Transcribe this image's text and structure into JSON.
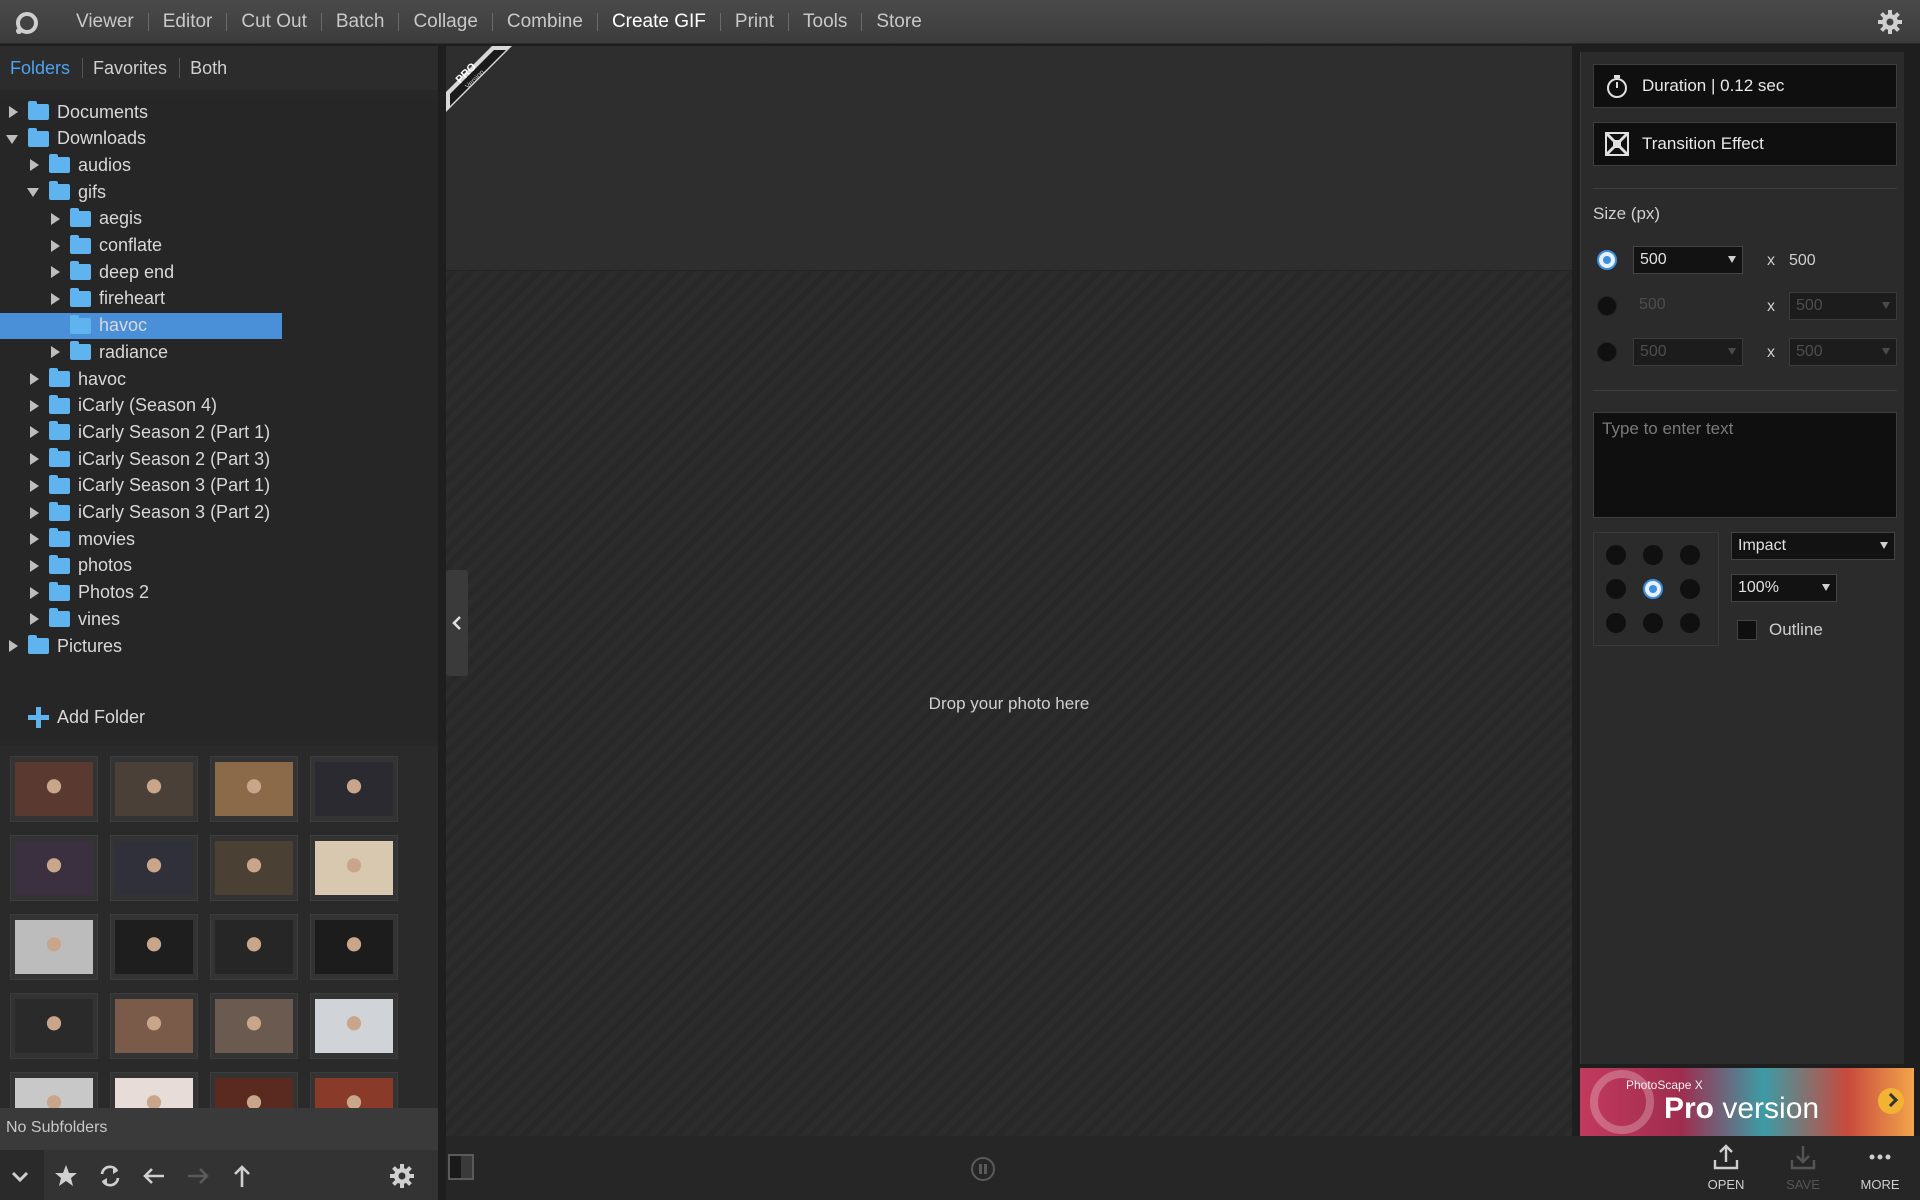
{
  "menu": {
    "items": [
      "Viewer",
      "Editor",
      "Cut Out",
      "Batch",
      "Collage",
      "Combine",
      "Create GIF",
      "Print",
      "Tools",
      "Store"
    ],
    "active": "Create GIF"
  },
  "left": {
    "tabs": [
      "Folders",
      "Favorites",
      "Both"
    ],
    "active_tab": "Folders",
    "tree": [
      {
        "label": "Documents",
        "level": 0,
        "expander": "collapsed"
      },
      {
        "label": "Downloads",
        "level": 0,
        "expander": "expanded"
      },
      {
        "label": "audios",
        "level": 1,
        "expander": "collapsed"
      },
      {
        "label": "gifs",
        "level": 1,
        "expander": "expanded"
      },
      {
        "label": "aegis",
        "level": 2,
        "expander": "collapsed"
      },
      {
        "label": "conflate",
        "level": 2,
        "expander": "collapsed"
      },
      {
        "label": "deep end",
        "level": 2,
        "expander": "collapsed"
      },
      {
        "label": "fireheart",
        "level": 2,
        "expander": "collapsed"
      },
      {
        "label": "havoc",
        "level": 2,
        "expander": "none",
        "selected": true
      },
      {
        "label": "radiance",
        "level": 2,
        "expander": "collapsed"
      },
      {
        "label": "havoc",
        "level": 1,
        "expander": "collapsed"
      },
      {
        "label": "iCarly (Season 4)",
        "level": 1,
        "expander": "collapsed"
      },
      {
        "label": "iCarly Season 2 (Part 1)",
        "level": 1,
        "expander": "collapsed"
      },
      {
        "label": "iCarly Season 2 (Part 3)",
        "level": 1,
        "expander": "collapsed"
      },
      {
        "label": "iCarly Season 3 (Part 1)",
        "level": 1,
        "expander": "collapsed"
      },
      {
        "label": "iCarly Season 3 (Part 2)",
        "level": 1,
        "expander": "collapsed"
      },
      {
        "label": "movies",
        "level": 1,
        "expander": "collapsed"
      },
      {
        "label": "photos",
        "level": 1,
        "expander": "collapsed"
      },
      {
        "label": "Photos 2",
        "level": 1,
        "expander": "collapsed"
      },
      {
        "label": "vines",
        "level": 1,
        "expander": "collapsed"
      },
      {
        "label": "Pictures",
        "level": 0,
        "expander": "collapsed"
      }
    ],
    "add_folder": "Add Folder",
    "status": "No Subfolders"
  },
  "center": {
    "pro_badge": "PRO",
    "pro_badge_sub": "Version",
    "drop_text": "Drop your photo here"
  },
  "right": {
    "duration_label": "Duration | 0.12 sec",
    "transition_label": "Transition Effect",
    "size_label": "Size (px)",
    "size_rows": [
      {
        "w": "500",
        "h": "500",
        "selected": true
      },
      {
        "w": "500",
        "h": "500",
        "selected": false
      },
      {
        "w": "500",
        "h": "500",
        "selected": false
      }
    ],
    "x_char": "x",
    "text_placeholder": "Type to enter text",
    "font": "Impact",
    "font_size": "100%",
    "outline_label": "Outline",
    "text_position": "center"
  },
  "ad": {
    "small": "PhotoScape X",
    "big_bold": "Pro",
    "big_rest": " version"
  },
  "actions": {
    "open": "OPEN",
    "save": "SAVE",
    "more": "MORE"
  },
  "colors": {
    "accent": "#4a90d9",
    "folder": "#5fb3ef",
    "active_tab": "#4ea3f0"
  }
}
